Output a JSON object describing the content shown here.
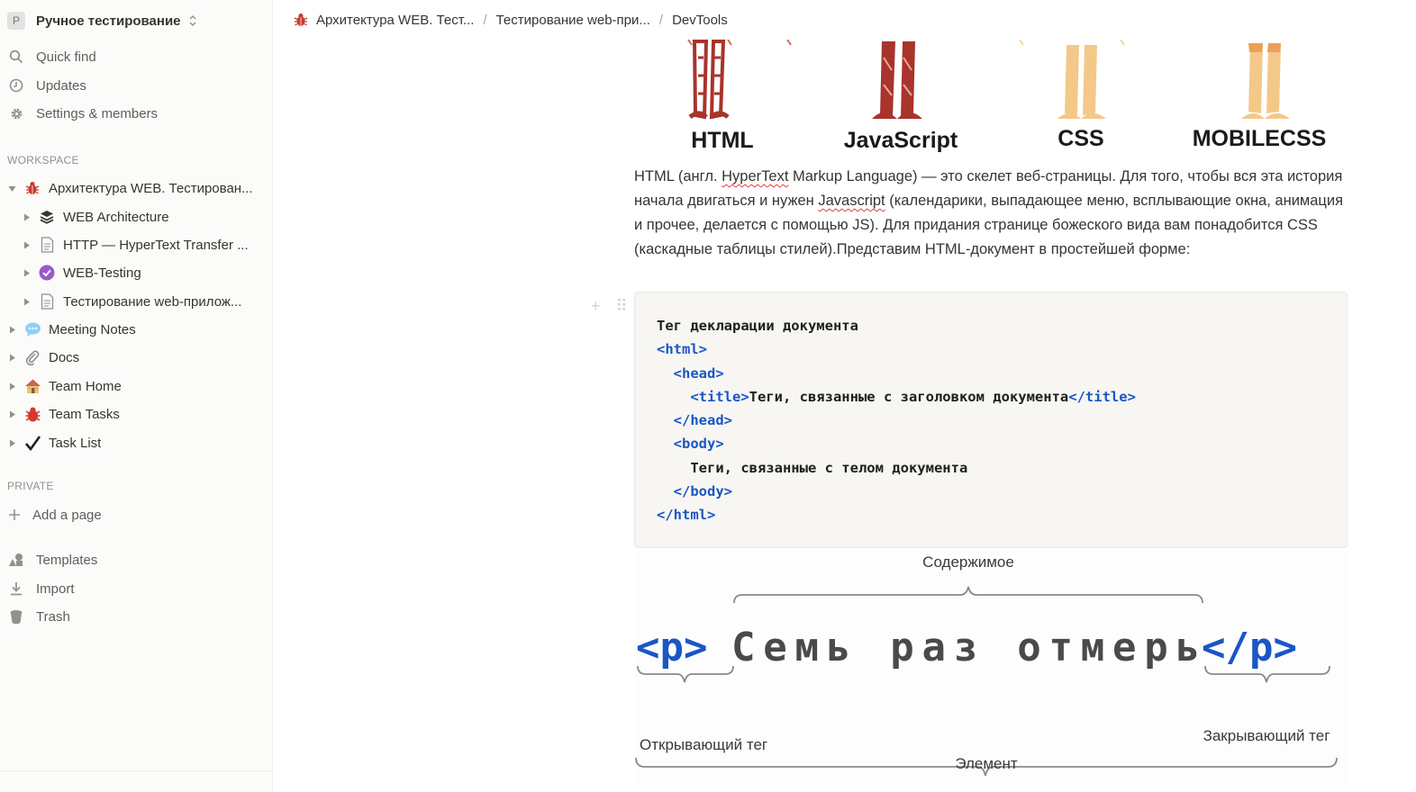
{
  "sidebar": {
    "workspace": {
      "avatar": "P",
      "name": "Ручное тестирование"
    },
    "nav": [
      {
        "icon": "search-icon",
        "label": "Quick find"
      },
      {
        "icon": "clock-icon",
        "label": "Updates"
      },
      {
        "icon": "gear-icon",
        "label": "Settings & members"
      }
    ],
    "workspace_label": "WORKSPACE",
    "tree": [
      {
        "level": 0,
        "expanded": true,
        "icon": "bug-icon",
        "label": "Архитектура WEB. Тестирован..."
      },
      {
        "level": 1,
        "expanded": false,
        "icon": "layers-icon",
        "label": "WEB Architecture"
      },
      {
        "level": 1,
        "expanded": false,
        "icon": "page-icon",
        "label": "HTTP — HyperText Transfer ..."
      },
      {
        "level": 1,
        "expanded": false,
        "icon": "purple-check-icon",
        "label": "WEB-Testing"
      },
      {
        "level": 1,
        "expanded": false,
        "icon": "page-icon",
        "label": "Тестирование web-прилож..."
      },
      {
        "level": 0,
        "expanded": false,
        "icon": "speech-bubble-icon",
        "label": "Meeting Notes"
      },
      {
        "level": 0,
        "expanded": false,
        "icon": "paperclip-icon",
        "label": "Docs"
      },
      {
        "level": 0,
        "expanded": false,
        "icon": "house-icon",
        "label": "Team Home"
      },
      {
        "level": 0,
        "expanded": false,
        "icon": "red-bug-icon",
        "label": "Team Tasks"
      },
      {
        "level": 0,
        "expanded": false,
        "icon": "checkmark-icon",
        "label": "Task List"
      }
    ],
    "private_label": "PRIVATE",
    "add_page": "Add a page",
    "footer": [
      {
        "icon": "templates-icon",
        "label": "Templates"
      },
      {
        "icon": "import-icon",
        "label": "Import"
      },
      {
        "icon": "trash-icon",
        "label": "Trash"
      }
    ]
  },
  "breadcrumb": [
    "Архитектура WEB. Тест...",
    "Тестирование web-при...",
    "DevTools"
  ],
  "hero": {
    "labels": [
      "HTML",
      "JavaScript",
      "CSS",
      "MOBILECSS"
    ]
  },
  "paragraph": {
    "p1": "HTML (англ. ",
    "u1": "HyperText",
    "p2": " Markup Language) — это скелет веб-страницы. Для того, чтобы вся эта история начала двигаться и нужен ",
    "u2": "Javascript",
    "p3": " (календарики, выпадающее меню, всплывающие окна, анимация и прочее, делается с помощью JS). Для придания странице божеского вида вам понадобится CSS (каскадные таблицы стилей).Представим HTML-документ в простейшей форме:"
  },
  "code": {
    "l1": "Тег декларации документа",
    "l2_tag": "<html>",
    "l3_tag": "<head>",
    "l4_open": "<title>",
    "l4_text": "Теги, связанные с заголовком документа",
    "l4_close": "</title>",
    "l5_tag": "</head>",
    "l6_tag": "<body>",
    "l7": "Теги, связанные с телом документа",
    "l8_tag": "</body>",
    "l9_tag": "</html>"
  },
  "diagram": {
    "content_label": "Содержимое",
    "open_tag": "<p>",
    "text": "Семь раз отмерь",
    "close_tag": "</p>",
    "opening_label": "Открывающий тег",
    "closing_label": "Закрывающий тег",
    "element_label": "Элемент"
  },
  "colors": {
    "tag_blue": "#1a56c4",
    "sidebar_bg": "#fbfbfa",
    "code_bg": "#f7f6f3",
    "bone_red": "#a8342b",
    "bone_tan": "#f3c889"
  }
}
